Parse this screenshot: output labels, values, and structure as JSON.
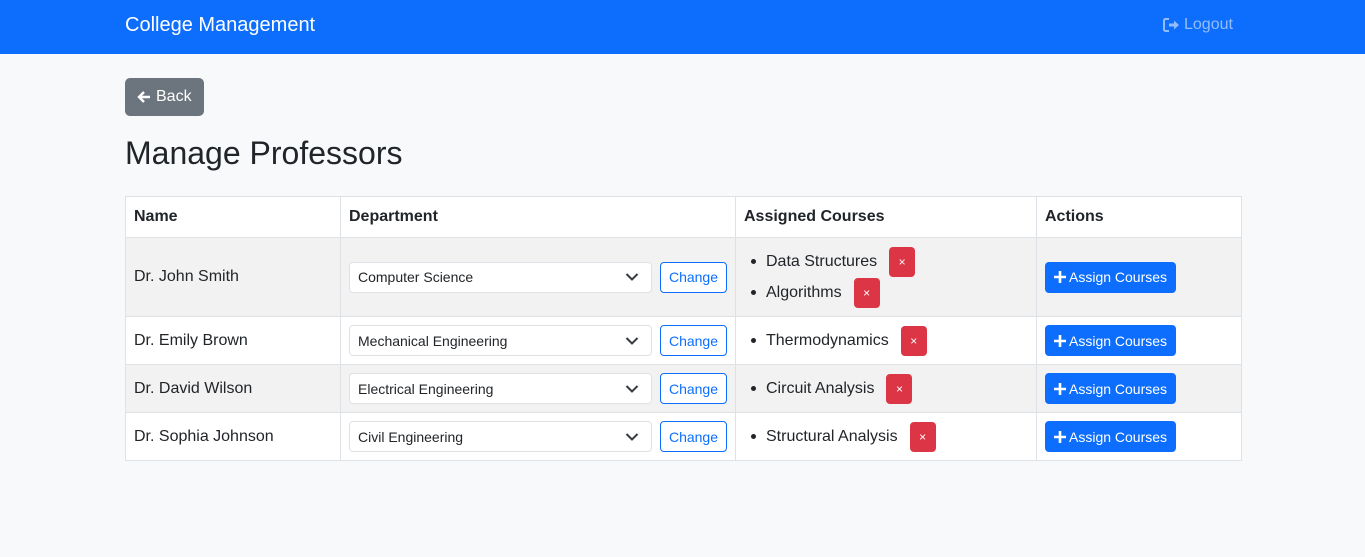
{
  "navbar": {
    "brand": "College Management",
    "logout_label": "Logout",
    "logout_icon": "sign-out-icon"
  },
  "back_label": "Back",
  "page_title": "Manage Professors",
  "table": {
    "headers": [
      "Name",
      "Department",
      "Assigned Courses",
      "Actions"
    ],
    "change_label": "Change",
    "remove_label": "×",
    "assign_label": "Assign Courses",
    "rows": [
      {
        "name": "Dr. John Smith",
        "department": "Computer Science",
        "courses": [
          "Data Structures",
          "Algorithms"
        ]
      },
      {
        "name": "Dr. Emily Brown",
        "department": "Mechanical Engineering",
        "courses": [
          "Thermodynamics"
        ]
      },
      {
        "name": "Dr. David Wilson",
        "department": "Electrical Engineering",
        "courses": [
          "Circuit Analysis"
        ]
      },
      {
        "name": "Dr. Sophia Johnson",
        "department": "Civil Engineering",
        "courses": [
          "Structural Analysis"
        ]
      }
    ]
  },
  "colors": {
    "primary": "#0d6efd",
    "danger": "#dc3545",
    "secondary": "#6c757d"
  }
}
